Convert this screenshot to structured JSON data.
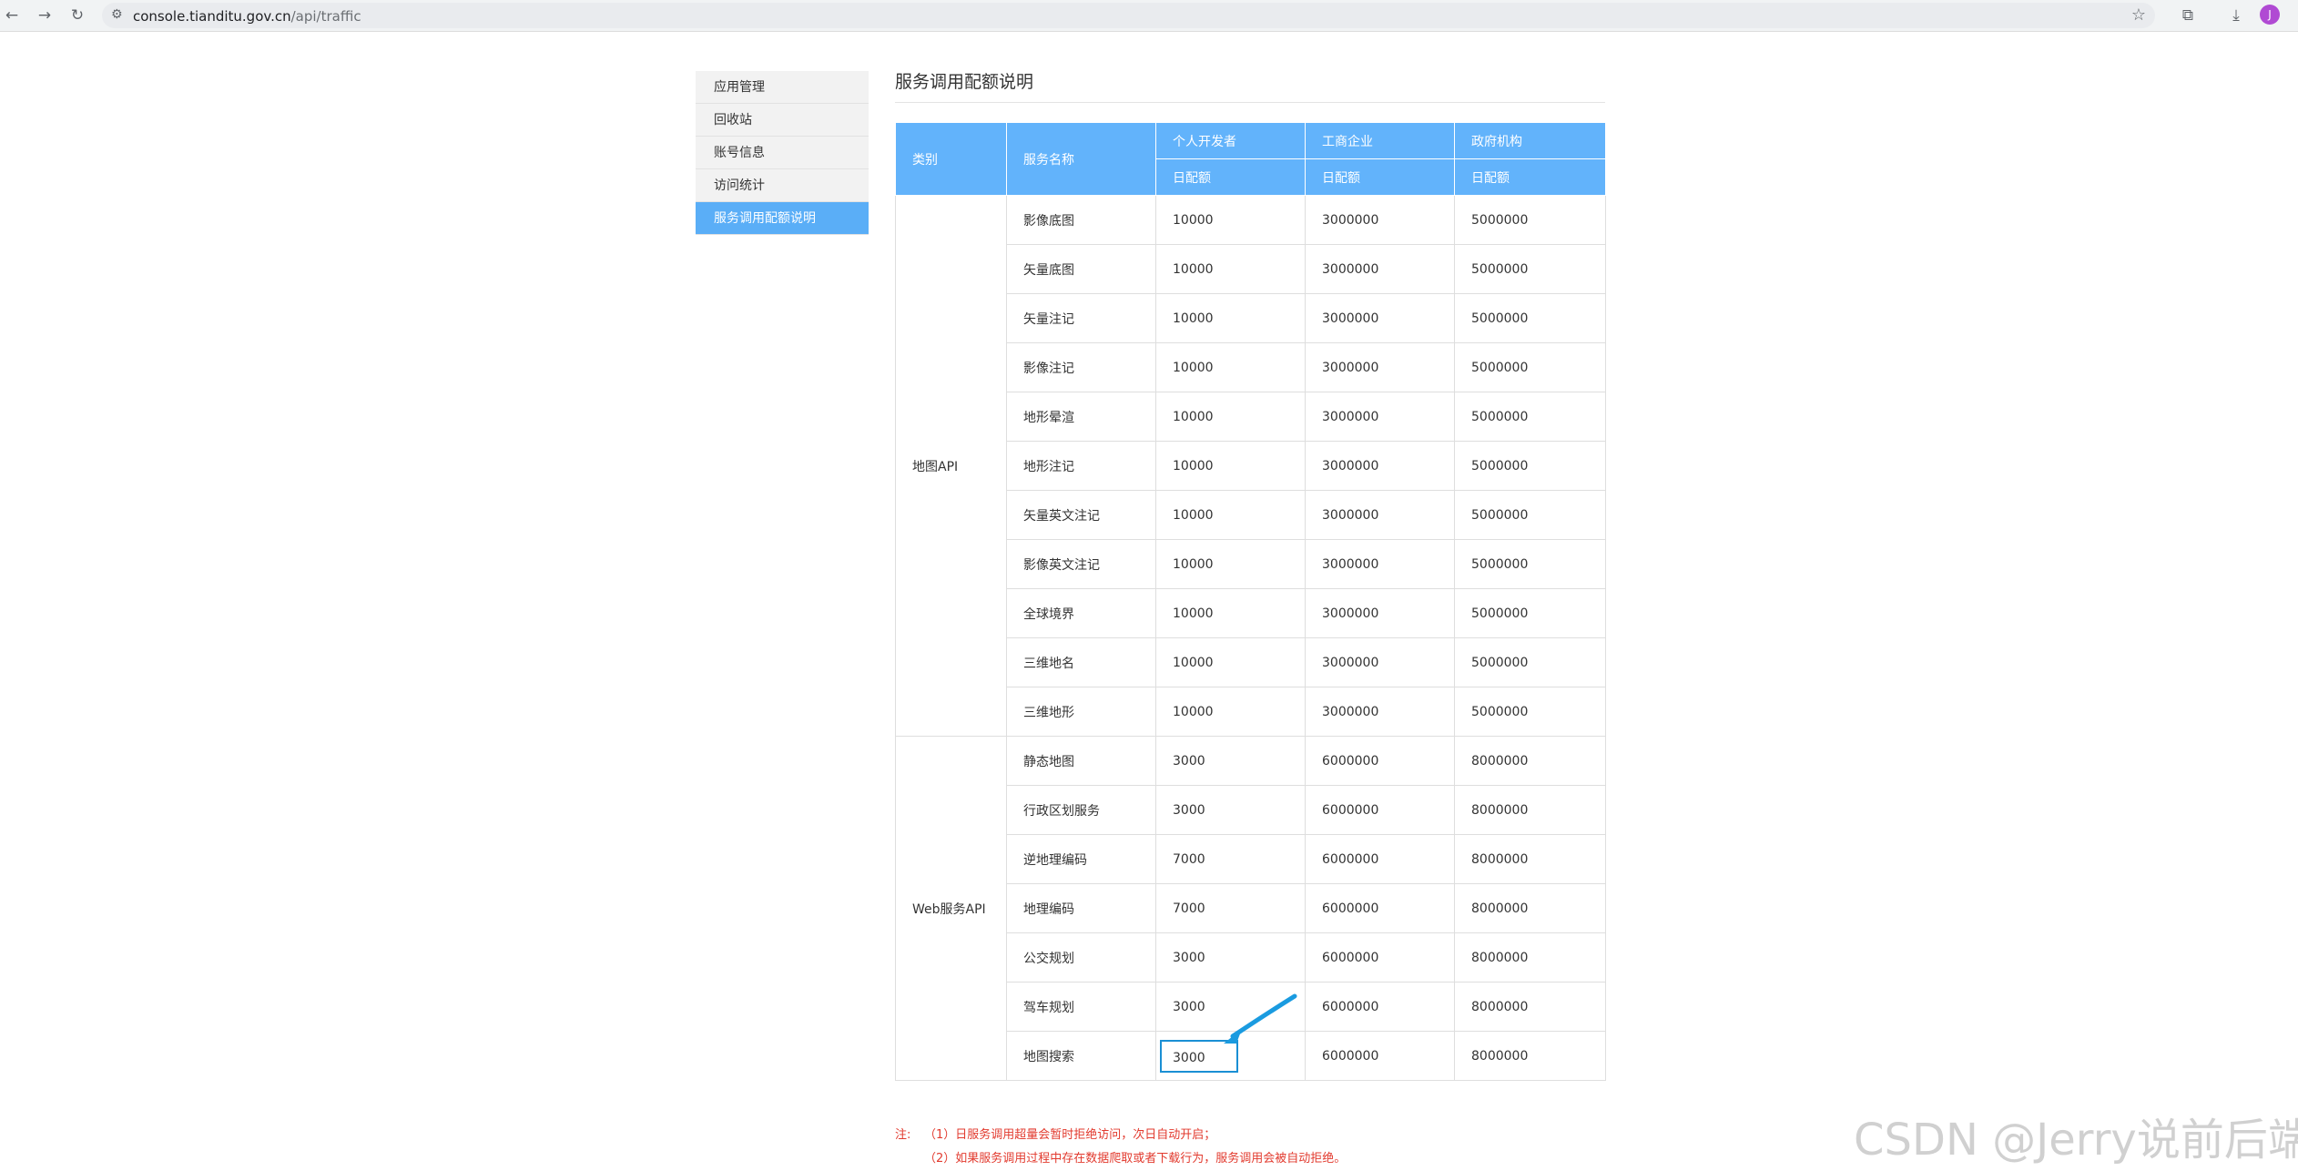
{
  "browser": {
    "url_host": "console.tianditu.gov.cn",
    "url_path": "/api/traffic",
    "avatar_letter": "J"
  },
  "sidebar": {
    "items": [
      {
        "label": "应用管理"
      },
      {
        "label": "回收站"
      },
      {
        "label": "账号信息"
      },
      {
        "label": "访问统计"
      },
      {
        "label": "服务调用配额说明"
      }
    ],
    "active_index": 4,
    "active_color": "#5aaef7"
  },
  "page": {
    "title": "服务调用配额说明"
  },
  "table": {
    "header_color": "#62b3fb",
    "headers": {
      "category": "类别",
      "service": "服务名称",
      "personal": "个人开发者",
      "business": "工商企业",
      "government": "政府机构",
      "daily_quota": "日配额"
    },
    "groups": [
      {
        "category": "地图API",
        "rows": [
          {
            "name": "影像底图",
            "personal": "10000",
            "business": "3000000",
            "government": "5000000"
          },
          {
            "name": "矢量底图",
            "personal": "10000",
            "business": "3000000",
            "government": "5000000"
          },
          {
            "name": "矢量注记",
            "personal": "10000",
            "business": "3000000",
            "government": "5000000"
          },
          {
            "name": "影像注记",
            "personal": "10000",
            "business": "3000000",
            "government": "5000000"
          },
          {
            "name": "地形晕渲",
            "personal": "10000",
            "business": "3000000",
            "government": "5000000"
          },
          {
            "name": "地形注记",
            "personal": "10000",
            "business": "3000000",
            "government": "5000000"
          },
          {
            "name": "矢量英文注记",
            "personal": "10000",
            "business": "3000000",
            "government": "5000000"
          },
          {
            "name": "影像英文注记",
            "personal": "10000",
            "business": "3000000",
            "government": "5000000"
          },
          {
            "name": "全球境界",
            "personal": "10000",
            "business": "3000000",
            "government": "5000000"
          },
          {
            "name": "三维地名",
            "personal": "10000",
            "business": "3000000",
            "government": "5000000"
          },
          {
            "name": "三维地形",
            "personal": "10000",
            "business": "3000000",
            "government": "5000000"
          }
        ]
      },
      {
        "category": "Web服务API",
        "rows": [
          {
            "name": "静态地图",
            "personal": "3000",
            "business": "6000000",
            "government": "8000000"
          },
          {
            "name": "行政区划服务",
            "personal": "3000",
            "business": "6000000",
            "government": "8000000"
          },
          {
            "name": "逆地理编码",
            "personal": "7000",
            "business": "6000000",
            "government": "8000000"
          },
          {
            "name": "地理编码",
            "personal": "7000",
            "business": "6000000",
            "government": "8000000"
          },
          {
            "name": "公交规划",
            "personal": "3000",
            "business": "6000000",
            "government": "8000000"
          },
          {
            "name": "驾车规划",
            "personal": "3000",
            "business": "6000000",
            "government": "8000000"
          },
          {
            "name": "地图搜索",
            "personal": "3000",
            "business": "6000000",
            "government": "8000000",
            "highlighted": true
          }
        ]
      }
    ]
  },
  "notes": {
    "prefix": "注:",
    "lines": [
      "（1）日服务调用超量会暂时拒绝访问，次日自动开启；",
      "（2）如果服务调用过程中存在数据爬取或者下载行为，服务调用会被自动拒绝。"
    ],
    "color": "#e23a2e"
  },
  "watermark": {
    "text": "CSDN @Jerry说前后端"
  },
  "annotation": {
    "arrow_color": "#1a9be0",
    "highlight_color": "#1a8fd4"
  }
}
